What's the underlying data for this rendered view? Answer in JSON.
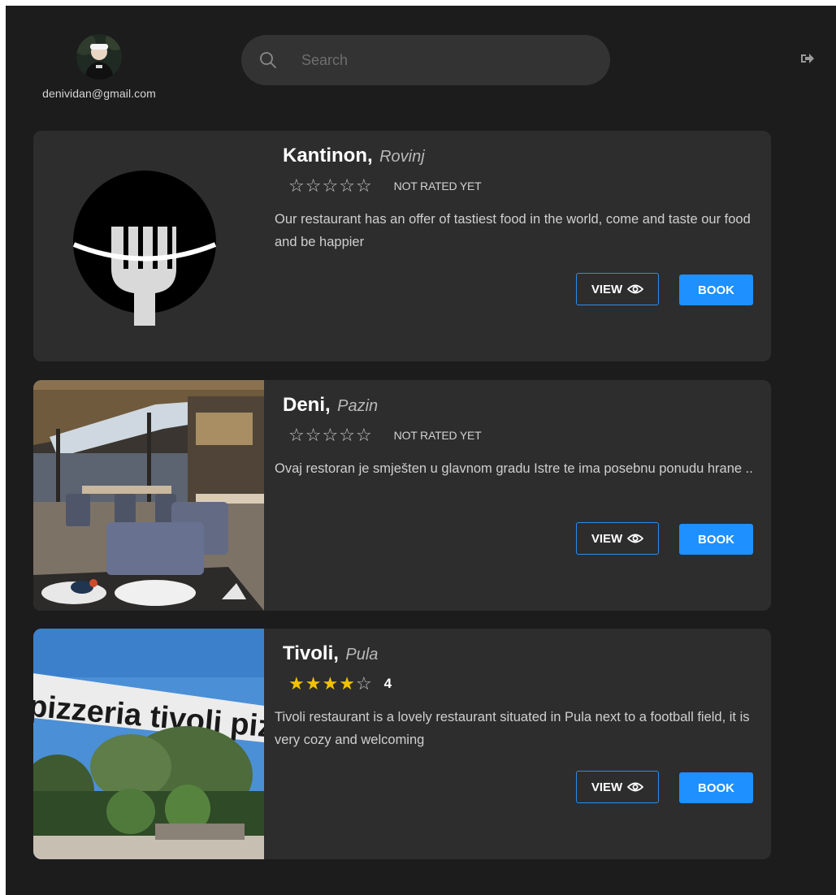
{
  "header": {
    "user_email": "denividan@gmail.com",
    "search_placeholder": "Search",
    "avatar_icon": "user-avatar",
    "logout_icon": "sign-out-icon"
  },
  "restaurants": [
    {
      "name": "Kantinon,",
      "city": "Rovinj",
      "rating": 0,
      "rating_label": "NOT RATED YET",
      "description": "Our restaurant has an offer of tastiest food in the world, come and taste our food and be happier",
      "view_label": "VIEW",
      "book_label": "BOOK",
      "image": "fork-logo"
    },
    {
      "name": "Deni,",
      "city": "Pazin",
      "rating": 0,
      "rating_label": "NOT RATED YET",
      "description": "Ovaj restoran je smješten u glavnom gradu Istre te ima posebnu ponudu hrane ..",
      "view_label": "VIEW",
      "book_label": "BOOK",
      "image": "restaurant-interior-photo"
    },
    {
      "name": "Tivoli,",
      "city": "Pula",
      "rating": 4,
      "rating_label": "4",
      "description": "Tivoli restaurant is a lovely restaurant situated in Pula next to a football field, it is very cozy and welcoming",
      "view_label": "VIEW",
      "book_label": "BOOK",
      "image": "pizzeria-storefront-photo",
      "storefront_sign": "pizzeria tivoli pizz"
    }
  ],
  "colors": {
    "background": "#1c1c1c",
    "card": "#2d2d2d",
    "accent": "#1e90ff",
    "star_filled": "#f2c200",
    "star_empty": "#c9c9c9"
  }
}
